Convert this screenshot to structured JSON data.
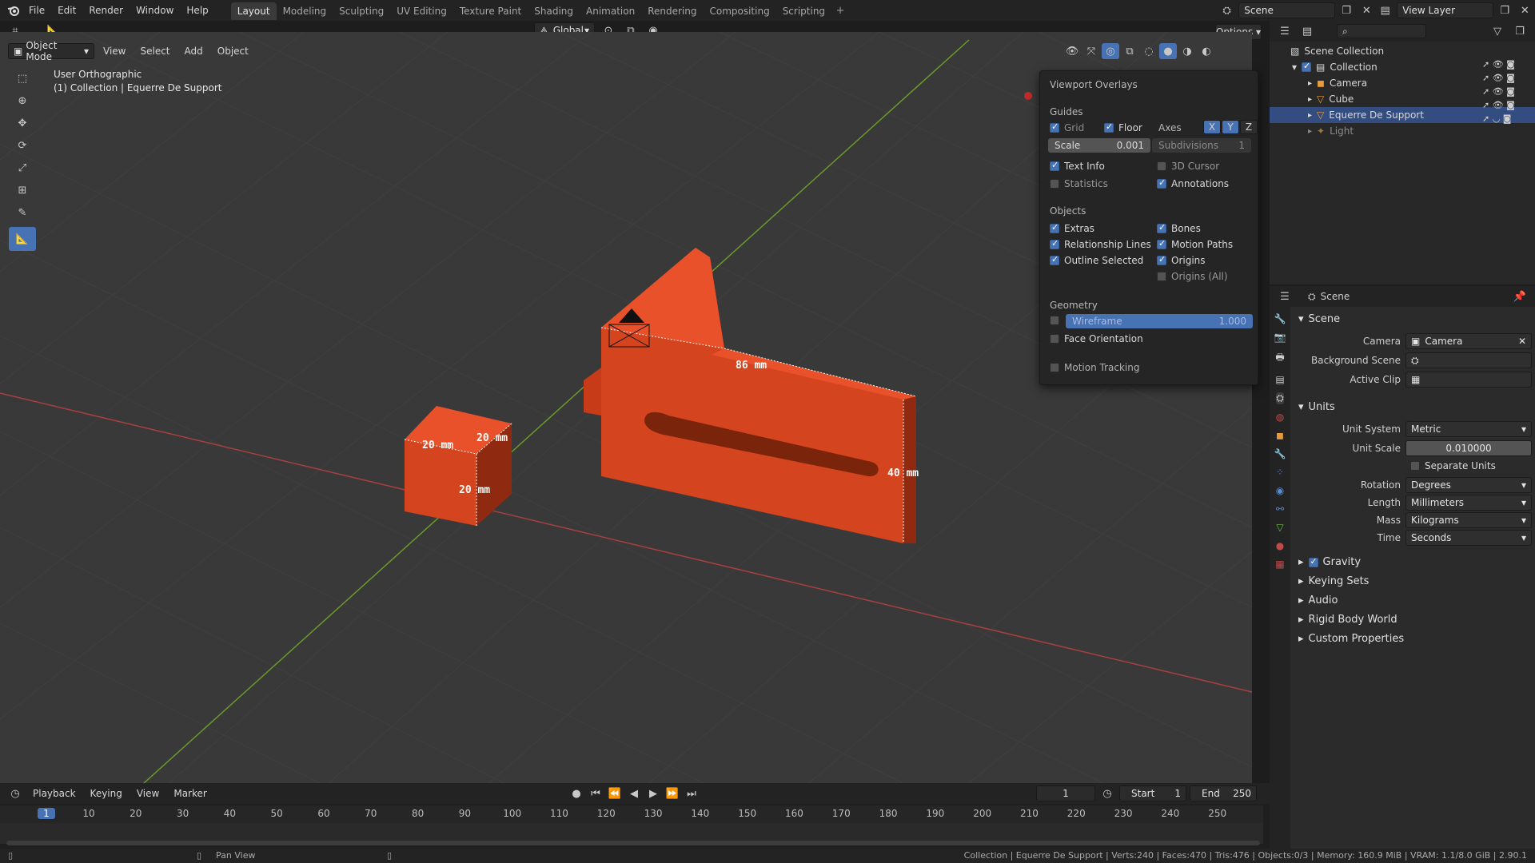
{
  "topbar": {
    "menus": [
      "File",
      "Edit",
      "Render",
      "Window",
      "Help"
    ],
    "workspaces": [
      "Layout",
      "Modeling",
      "Sculpting",
      "UV Editing",
      "Texture Paint",
      "Shading",
      "Animation",
      "Rendering",
      "Compositing",
      "Scripting"
    ],
    "active_workspace": "Layout",
    "scene_name": "Scene",
    "view_layer": "View Layer"
  },
  "toolbar_header": {
    "transform_orientation": "Global",
    "options": "Options"
  },
  "viewport_header": {
    "mode": "Object Mode",
    "menus": [
      "View",
      "Select",
      "Add",
      "Object"
    ]
  },
  "viewport_info": {
    "view_name": "User Orthographic",
    "collection_line": "(1) Collection | Equerre De Support"
  },
  "dimensions": {
    "cube_top_left": "20 mm",
    "cube_top_right": "20 mm",
    "cube_height": "20 mm",
    "support_length": "86 mm",
    "support_height": "40 mm"
  },
  "overlays": {
    "title": "Viewport Overlays",
    "guides_header": "Guides",
    "grid": "Grid",
    "floor": "Floor",
    "axes": "Axes",
    "axis_x": "X",
    "axis_y": "Y",
    "axis_z": "Z",
    "scale_label": "Scale",
    "scale_value": "0.001",
    "subdivisions_label": "Subdivisions",
    "subdivisions_value": "1",
    "text_info": "Text Info",
    "cursor_3d": "3D Cursor",
    "statistics": "Statistics",
    "annotations": "Annotations",
    "objects_header": "Objects",
    "extras": "Extras",
    "bones": "Bones",
    "relationship_lines": "Relationship Lines",
    "motion_paths": "Motion Paths",
    "outline_selected": "Outline Selected",
    "origins": "Origins",
    "origins_all": "Origins (All)",
    "geometry_header": "Geometry",
    "wireframe": "Wireframe",
    "wireframe_value": "1.000",
    "face_orientation": "Face Orientation",
    "motion_tracking": "Motion Tracking"
  },
  "outliner": {
    "root": "Scene Collection",
    "items": [
      {
        "name": "Collection",
        "icon": "collection-icon"
      },
      {
        "name": "Camera",
        "icon": "camera-icon"
      },
      {
        "name": "Cube",
        "icon": "mesh-icon"
      },
      {
        "name": "Equerre De Support",
        "icon": "mesh-icon"
      },
      {
        "name": "Light",
        "icon": "light-icon"
      }
    ]
  },
  "properties": {
    "breadcrumb": "Scene",
    "scene_section": "Scene",
    "camera_label": "Camera",
    "camera_value": "Camera",
    "background_scene_label": "Background Scene",
    "active_clip_label": "Active Clip",
    "units_section": "Units",
    "unit_system_label": "Unit System",
    "unit_system_value": "Metric",
    "unit_scale_label": "Unit Scale",
    "unit_scale_value": "0.010000",
    "separate_units": "Separate Units",
    "rotation_label": "Rotation",
    "rotation_value": "Degrees",
    "length_label": "Length",
    "length_value": "Millimeters",
    "mass_label": "Mass",
    "mass_value": "Kilograms",
    "time_label": "Time",
    "time_value": "Seconds",
    "gravity": "Gravity",
    "keying_sets": "Keying Sets",
    "audio": "Audio",
    "rigid_body_world": "Rigid Body World",
    "custom_properties": "Custom Properties"
  },
  "timeline": {
    "menus": [
      "Playback",
      "Keying",
      "View",
      "Marker"
    ],
    "current_frame": "1",
    "start_label": "Start",
    "start_value": "1",
    "end_label": "End",
    "end_value": "250",
    "ticks": [
      "1",
      "10",
      "20",
      "30",
      "40",
      "50",
      "60",
      "70",
      "80",
      "90",
      "100",
      "110",
      "120",
      "130",
      "140",
      "150",
      "160",
      "170",
      "180",
      "190",
      "200",
      "210",
      "220",
      "230",
      "240",
      "250"
    ]
  },
  "statusbar": {
    "hint": "Pan View",
    "stats": "Collection | Equerre De Support | Verts:240 | Faces:470 | Tris:476 | Objects:0/3 | Memory: 160.9 MiB | VRAM: 1.1/8.0 GiB | 2.90.1"
  },
  "colors": {
    "accent": "#4772b3",
    "object_orange": "#e8512a",
    "x_axis": "#b8403f",
    "y_axis": "#6a9a2a"
  }
}
